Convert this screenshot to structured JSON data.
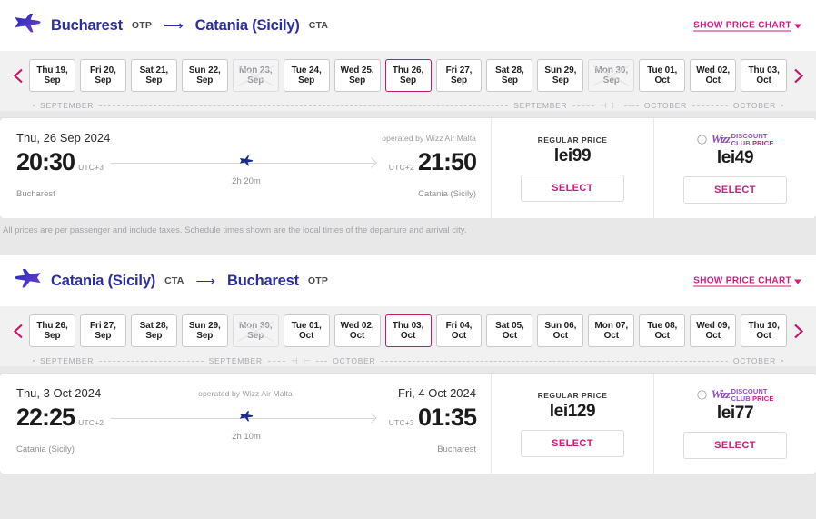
{
  "legs": [
    {
      "id": "outbound",
      "direction_icon": "plane-right-icon",
      "origin_city": "Bucharest",
      "origin_code": "OTP",
      "arrow": "⟶",
      "dest_city": "Catania (Sicily)",
      "dest_code": "CTA",
      "price_chart_link": "SHOW PRICE CHART",
      "prev_icon": "chevron-left-icon",
      "next_icon": "chevron-right-icon",
      "dates": [
        {
          "top": "Thu 19,",
          "bottom": "Sep",
          "state": "available"
        },
        {
          "top": "Fri 20,",
          "bottom": "Sep",
          "state": "available"
        },
        {
          "top": "Sat 21,",
          "bottom": "Sep",
          "state": "available"
        },
        {
          "top": "Sun 22,",
          "bottom": "Sep",
          "state": "available"
        },
        {
          "top": "Mon 23,",
          "bottom": "Sep",
          "state": "disabled"
        },
        {
          "top": "Tue 24,",
          "bottom": "Sep",
          "state": "available"
        },
        {
          "top": "Wed 25,",
          "bottom": "Sep",
          "state": "available"
        },
        {
          "top": "Thu 26,",
          "bottom": "Sep",
          "state": "selected"
        },
        {
          "top": "Fri 27,",
          "bottom": "Sep",
          "state": "available"
        },
        {
          "top": "Sat 28,",
          "bottom": "Sep",
          "state": "available"
        },
        {
          "top": "Sun 29,",
          "bottom": "Sep",
          "state": "available"
        },
        {
          "top": "Mon 30,",
          "bottom": "Sep",
          "state": "disabled"
        },
        {
          "top": "Tue 01,",
          "bottom": "Oct",
          "state": "available"
        },
        {
          "top": "Wed 02,",
          "bottom": "Oct",
          "state": "available"
        },
        {
          "top": "Thu 03,",
          "bottom": "Oct",
          "state": "available"
        }
      ],
      "month_ruler": [
        {
          "kind": "dot"
        },
        {
          "kind": "label",
          "text": "SEPTEMBER"
        },
        {
          "kind": "line",
          "grow": 58
        },
        {
          "kind": "label",
          "text": "SEPTEMBER"
        },
        {
          "kind": "line",
          "grow": 3
        },
        {
          "kind": "tick",
          "text": "⊣"
        },
        {
          "kind": "tick",
          "text": "⊢"
        },
        {
          "kind": "line",
          "grow": 2
        },
        {
          "kind": "label",
          "text": "OCTOBER"
        },
        {
          "kind": "line",
          "grow": 5
        },
        {
          "kind": "label",
          "text": "OCTOBER"
        },
        {
          "kind": "dot"
        }
      ],
      "flight": {
        "depart_date": "Thu, 26 Sep 2024",
        "arrive_date": "",
        "operated_by": "operated by Wizz Air Malta",
        "operated_centered": false,
        "depart_time": "20:30",
        "depart_utc": "UTC+3",
        "arrive_time": "21:50",
        "arrive_utc": "UTC+2",
        "duration": "2h 20m",
        "origin_city": "Bucharest",
        "dest_city": "Catania (Sicily)",
        "plane_icon": "plane-right-icon"
      },
      "regular": {
        "label": "REGULAR PRICE",
        "amount": "lei99",
        "select_label": "SELECT"
      },
      "discount": {
        "info_icon": "info-icon",
        "brand": "Wizz",
        "line1": "DISCOUNT",
        "line2a": "CLUB",
        "line2b": "PRICE",
        "amount": "lei49",
        "select_label": "SELECT"
      },
      "disclaimer": "All prices are per passenger and include taxes. Schedule times shown are the local times of the departure and arrival city."
    },
    {
      "id": "return",
      "direction_icon": "plane-left-icon",
      "origin_city": "Catania (Sicily)",
      "origin_code": "CTA",
      "arrow": "⟶",
      "dest_city": "Bucharest",
      "dest_code": "OTP",
      "price_chart_link": "SHOW PRICE CHART",
      "prev_icon": "chevron-left-icon",
      "next_icon": "chevron-right-icon",
      "dates": [
        {
          "top": "Thu 26,",
          "bottom": "Sep",
          "state": "available"
        },
        {
          "top": "Fri 27,",
          "bottom": "Sep",
          "state": "available"
        },
        {
          "top": "Sat 28,",
          "bottom": "Sep",
          "state": "available"
        },
        {
          "top": "Sun 29,",
          "bottom": "Sep",
          "state": "available"
        },
        {
          "top": "Mon 30,",
          "bottom": "Sep",
          "state": "disabled"
        },
        {
          "top": "Tue 01,",
          "bottom": "Oct",
          "state": "available"
        },
        {
          "top": "Wed 02,",
          "bottom": "Oct",
          "state": "available"
        },
        {
          "top": "Thu 03,",
          "bottom": "Oct",
          "state": "selected"
        },
        {
          "top": "Fri 04,",
          "bottom": "Oct",
          "state": "available"
        },
        {
          "top": "Sat 05,",
          "bottom": "Oct",
          "state": "available"
        },
        {
          "top": "Sun 06,",
          "bottom": "Oct",
          "state": "available"
        },
        {
          "top": "Mon 07,",
          "bottom": "Oct",
          "state": "available"
        },
        {
          "top": "Tue 08,",
          "bottom": "Oct",
          "state": "available"
        },
        {
          "top": "Wed 09,",
          "bottom": "Oct",
          "state": "available"
        },
        {
          "top": "Thu 10,",
          "bottom": "Oct",
          "state": "available"
        }
      ],
      "month_ruler": [
        {
          "kind": "dot"
        },
        {
          "kind": "label",
          "text": "SEPTEMBER"
        },
        {
          "kind": "line",
          "grow": 18
        },
        {
          "kind": "label",
          "text": "SEPTEMBER"
        },
        {
          "kind": "line",
          "grow": 3
        },
        {
          "kind": "tick",
          "text": "⊣"
        },
        {
          "kind": "tick",
          "text": "⊢"
        },
        {
          "kind": "line",
          "grow": 2
        },
        {
          "kind": "label",
          "text": "OCTOBER"
        },
        {
          "kind": "line",
          "grow": 60
        },
        {
          "kind": "label",
          "text": "OCTOBER"
        },
        {
          "kind": "dot"
        }
      ],
      "flight": {
        "depart_date": "Thu, 3 Oct 2024",
        "arrive_date": "Fri, 4 Oct 2024",
        "operated_by": "operated by Wizz Air Malta",
        "operated_centered": true,
        "depart_time": "22:25",
        "depart_utc": "UTC+2",
        "arrive_time": "01:35",
        "arrive_utc": "UTC+3",
        "duration": "2h 10m",
        "origin_city": "Catania (Sicily)",
        "dest_city": "Bucharest",
        "plane_icon": "plane-right-icon"
      },
      "regular": {
        "label": "REGULAR PRICE",
        "amount": "lei129",
        "select_label": "SELECT"
      },
      "discount": {
        "info_icon": "info-icon",
        "brand": "Wizz",
        "line1": "DISCOUNT",
        "line2a": "CLUB",
        "line2b": "PRICE",
        "amount": "lei77",
        "select_label": "SELECT"
      },
      "disclaimer": ""
    }
  ],
  "colors": {
    "brand_blue": "#2c2e9e",
    "accent_magenta": "#d2197d",
    "wdc_purple": "#8e4fc0",
    "page_bg": "#e8e8e9",
    "strip_bg": "#f1f1f2"
  }
}
